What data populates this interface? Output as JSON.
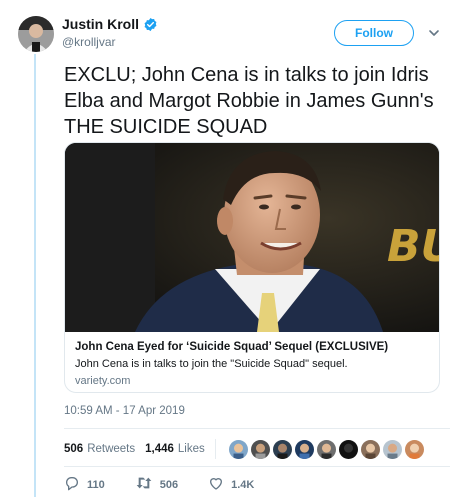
{
  "author": {
    "display_name": "Justin Kroll",
    "handle": "@krolljvar"
  },
  "follow_label": "Follow",
  "tweet": {
    "text": "EXCLU; John Cena is in talks to join Idris Elba and Margot Robbie in James Gunn's THE SUICIDE SQUAD"
  },
  "card": {
    "title": "John Cena Eyed for ‘Suicide Squad’ Sequel (EXCLUSIVE)",
    "description": "John Cena is in talks to join the \"Suicide Squad\" sequel.",
    "domain": "variety.com",
    "image_backdrop_text": "BU"
  },
  "timestamp": "10:59 AM - 17 Apr 2019",
  "stats": {
    "retweets_count": "506",
    "retweets_label": "Retweets",
    "likes_count": "1,446",
    "likes_label": "Likes"
  },
  "actions": {
    "replies": "110",
    "retweets": "506",
    "likes": "1.4K"
  },
  "colors": {
    "accent": "#1da1f2",
    "muted": "#657786",
    "rail": "#c4e4f7"
  }
}
